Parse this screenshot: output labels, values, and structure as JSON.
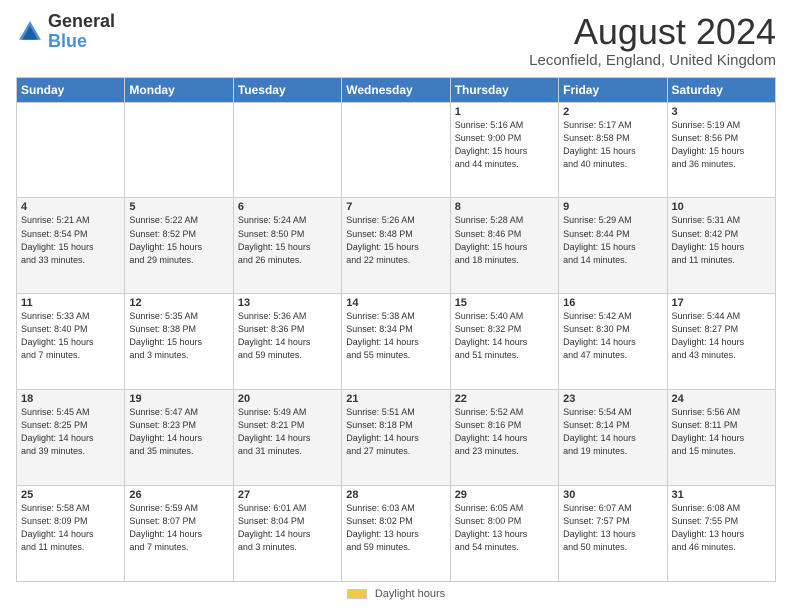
{
  "logo": {
    "line1": "General",
    "line2": "Blue"
  },
  "title": "August 2024",
  "subtitle": "Leconfield, England, United Kingdom",
  "weekdays": [
    "Sunday",
    "Monday",
    "Tuesday",
    "Wednesday",
    "Thursday",
    "Friday",
    "Saturday"
  ],
  "weeks": [
    [
      {
        "day": "",
        "info": ""
      },
      {
        "day": "",
        "info": ""
      },
      {
        "day": "",
        "info": ""
      },
      {
        "day": "",
        "info": ""
      },
      {
        "day": "1",
        "info": "Sunrise: 5:16 AM\nSunset: 9:00 PM\nDaylight: 15 hours\nand 44 minutes."
      },
      {
        "day": "2",
        "info": "Sunrise: 5:17 AM\nSunset: 8:58 PM\nDaylight: 15 hours\nand 40 minutes."
      },
      {
        "day": "3",
        "info": "Sunrise: 5:19 AM\nSunset: 8:56 PM\nDaylight: 15 hours\nand 36 minutes."
      }
    ],
    [
      {
        "day": "4",
        "info": "Sunrise: 5:21 AM\nSunset: 8:54 PM\nDaylight: 15 hours\nand 33 minutes."
      },
      {
        "day": "5",
        "info": "Sunrise: 5:22 AM\nSunset: 8:52 PM\nDaylight: 15 hours\nand 29 minutes."
      },
      {
        "day": "6",
        "info": "Sunrise: 5:24 AM\nSunset: 8:50 PM\nDaylight: 15 hours\nand 26 minutes."
      },
      {
        "day": "7",
        "info": "Sunrise: 5:26 AM\nSunset: 8:48 PM\nDaylight: 15 hours\nand 22 minutes."
      },
      {
        "day": "8",
        "info": "Sunrise: 5:28 AM\nSunset: 8:46 PM\nDaylight: 15 hours\nand 18 minutes."
      },
      {
        "day": "9",
        "info": "Sunrise: 5:29 AM\nSunset: 8:44 PM\nDaylight: 15 hours\nand 14 minutes."
      },
      {
        "day": "10",
        "info": "Sunrise: 5:31 AM\nSunset: 8:42 PM\nDaylight: 15 hours\nand 11 minutes."
      }
    ],
    [
      {
        "day": "11",
        "info": "Sunrise: 5:33 AM\nSunset: 8:40 PM\nDaylight: 15 hours\nand 7 minutes."
      },
      {
        "day": "12",
        "info": "Sunrise: 5:35 AM\nSunset: 8:38 PM\nDaylight: 15 hours\nand 3 minutes."
      },
      {
        "day": "13",
        "info": "Sunrise: 5:36 AM\nSunset: 8:36 PM\nDaylight: 14 hours\nand 59 minutes."
      },
      {
        "day": "14",
        "info": "Sunrise: 5:38 AM\nSunset: 8:34 PM\nDaylight: 14 hours\nand 55 minutes."
      },
      {
        "day": "15",
        "info": "Sunrise: 5:40 AM\nSunset: 8:32 PM\nDaylight: 14 hours\nand 51 minutes."
      },
      {
        "day": "16",
        "info": "Sunrise: 5:42 AM\nSunset: 8:30 PM\nDaylight: 14 hours\nand 47 minutes."
      },
      {
        "day": "17",
        "info": "Sunrise: 5:44 AM\nSunset: 8:27 PM\nDaylight: 14 hours\nand 43 minutes."
      }
    ],
    [
      {
        "day": "18",
        "info": "Sunrise: 5:45 AM\nSunset: 8:25 PM\nDaylight: 14 hours\nand 39 minutes."
      },
      {
        "day": "19",
        "info": "Sunrise: 5:47 AM\nSunset: 8:23 PM\nDaylight: 14 hours\nand 35 minutes."
      },
      {
        "day": "20",
        "info": "Sunrise: 5:49 AM\nSunset: 8:21 PM\nDaylight: 14 hours\nand 31 minutes."
      },
      {
        "day": "21",
        "info": "Sunrise: 5:51 AM\nSunset: 8:18 PM\nDaylight: 14 hours\nand 27 minutes."
      },
      {
        "day": "22",
        "info": "Sunrise: 5:52 AM\nSunset: 8:16 PM\nDaylight: 14 hours\nand 23 minutes."
      },
      {
        "day": "23",
        "info": "Sunrise: 5:54 AM\nSunset: 8:14 PM\nDaylight: 14 hours\nand 19 minutes."
      },
      {
        "day": "24",
        "info": "Sunrise: 5:56 AM\nSunset: 8:11 PM\nDaylight: 14 hours\nand 15 minutes."
      }
    ],
    [
      {
        "day": "25",
        "info": "Sunrise: 5:58 AM\nSunset: 8:09 PM\nDaylight: 14 hours\nand 11 minutes."
      },
      {
        "day": "26",
        "info": "Sunrise: 5:59 AM\nSunset: 8:07 PM\nDaylight: 14 hours\nand 7 minutes."
      },
      {
        "day": "27",
        "info": "Sunrise: 6:01 AM\nSunset: 8:04 PM\nDaylight: 14 hours\nand 3 minutes."
      },
      {
        "day": "28",
        "info": "Sunrise: 6:03 AM\nSunset: 8:02 PM\nDaylight: 13 hours\nand 59 minutes."
      },
      {
        "day": "29",
        "info": "Sunrise: 6:05 AM\nSunset: 8:00 PM\nDaylight: 13 hours\nand 54 minutes."
      },
      {
        "day": "30",
        "info": "Sunrise: 6:07 AM\nSunset: 7:57 PM\nDaylight: 13 hours\nand 50 minutes."
      },
      {
        "day": "31",
        "info": "Sunrise: 6:08 AM\nSunset: 7:55 PM\nDaylight: 13 hours\nand 46 minutes."
      }
    ]
  ],
  "footer": {
    "daylight_label": "Daylight hours"
  }
}
